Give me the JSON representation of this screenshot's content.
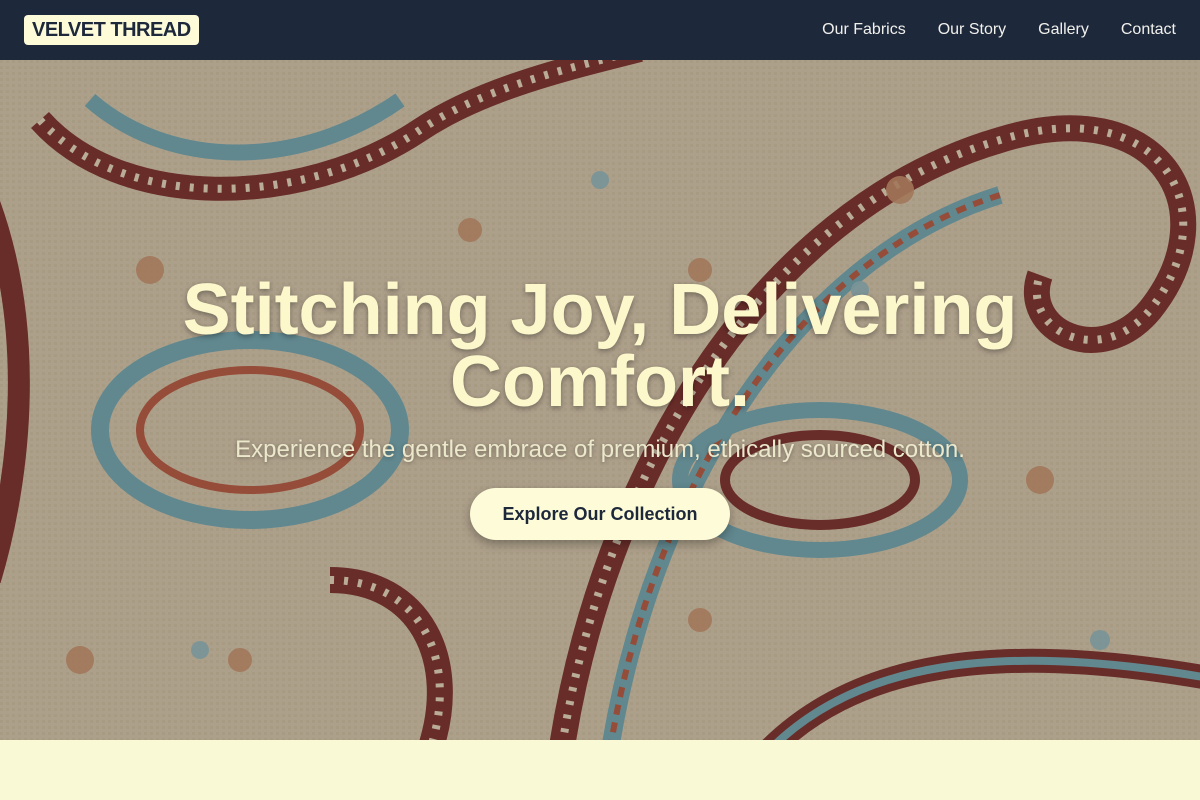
{
  "header": {
    "brand": "VELVET THREAD",
    "nav": [
      {
        "label": "Our Fabrics"
      },
      {
        "label": "Our Story"
      },
      {
        "label": "Gallery"
      },
      {
        "label": "Contact"
      }
    ]
  },
  "hero": {
    "headline": "Stitching Joy, Delivering Comfort.",
    "subheadline": "Experience the gentle embrace of premium, ethically sourced cotton.",
    "cta_label": "Explore Our Collection",
    "background": "paisley-fabric-image"
  },
  "colors": {
    "header_bg": "#1e283b",
    "accent_cream": "#fdfbd8",
    "page_bg": "#faf9d6",
    "paisley_red": "#7a2a2a",
    "paisley_blue": "#6fa8b8",
    "fabric_base": "#d8c8b0"
  }
}
